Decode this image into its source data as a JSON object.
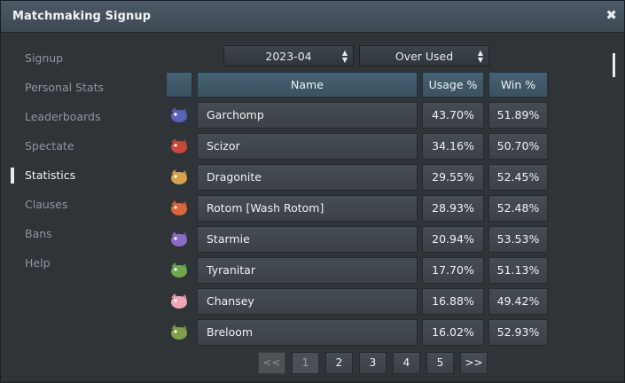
{
  "window": {
    "title": "Matchmaking Signup",
    "close_icon": "close-icon"
  },
  "sidebar": {
    "items": [
      {
        "label": "Signup",
        "active": false
      },
      {
        "label": "Personal Stats",
        "active": false
      },
      {
        "label": "Leaderboards",
        "active": false
      },
      {
        "label": "Spectate",
        "active": false
      },
      {
        "label": "Statistics",
        "active": true
      },
      {
        "label": "Clauses",
        "active": false
      },
      {
        "label": "Bans",
        "active": false
      },
      {
        "label": "Help",
        "active": false
      }
    ]
  },
  "filters": {
    "month": "2023-04",
    "tier": "Over Used"
  },
  "table": {
    "headers": {
      "icon": "",
      "name": "Name",
      "usage": "Usage %",
      "win": "Win %"
    },
    "rows": [
      {
        "name": "Garchomp",
        "usage": "43.70%",
        "win": "51.89%",
        "icon": "garchomp-sprite-icon",
        "color": "#5a63b8"
      },
      {
        "name": "Scizor",
        "usage": "34.16%",
        "win": "50.70%",
        "icon": "scizor-sprite-icon",
        "color": "#c8483a"
      },
      {
        "name": "Dragonite",
        "usage": "29.55%",
        "win": "52.45%",
        "icon": "dragonite-sprite-icon",
        "color": "#d9a24a"
      },
      {
        "name": "Rotom [Wash Rotom]",
        "usage": "28.93%",
        "win": "52.48%",
        "icon": "rotom-wash-sprite-icon",
        "color": "#d8663a"
      },
      {
        "name": "Starmie",
        "usage": "20.94%",
        "win": "53.53%",
        "icon": "starmie-sprite-icon",
        "color": "#8b6bc4"
      },
      {
        "name": "Tyranitar",
        "usage": "17.70%",
        "win": "51.13%",
        "icon": "tyranitar-sprite-icon",
        "color": "#6fa84a"
      },
      {
        "name": "Chansey",
        "usage": "16.88%",
        "win": "49.42%",
        "icon": "chansey-sprite-icon",
        "color": "#f0a6b4"
      },
      {
        "name": "Breloom",
        "usage": "16.02%",
        "win": "52.93%",
        "icon": "breloom-sprite-icon",
        "color": "#7fa04a"
      }
    ]
  },
  "pagination": {
    "prev": "<<",
    "pages": [
      "1",
      "2",
      "3",
      "4",
      "5"
    ],
    "next": ">>",
    "current": "1"
  }
}
